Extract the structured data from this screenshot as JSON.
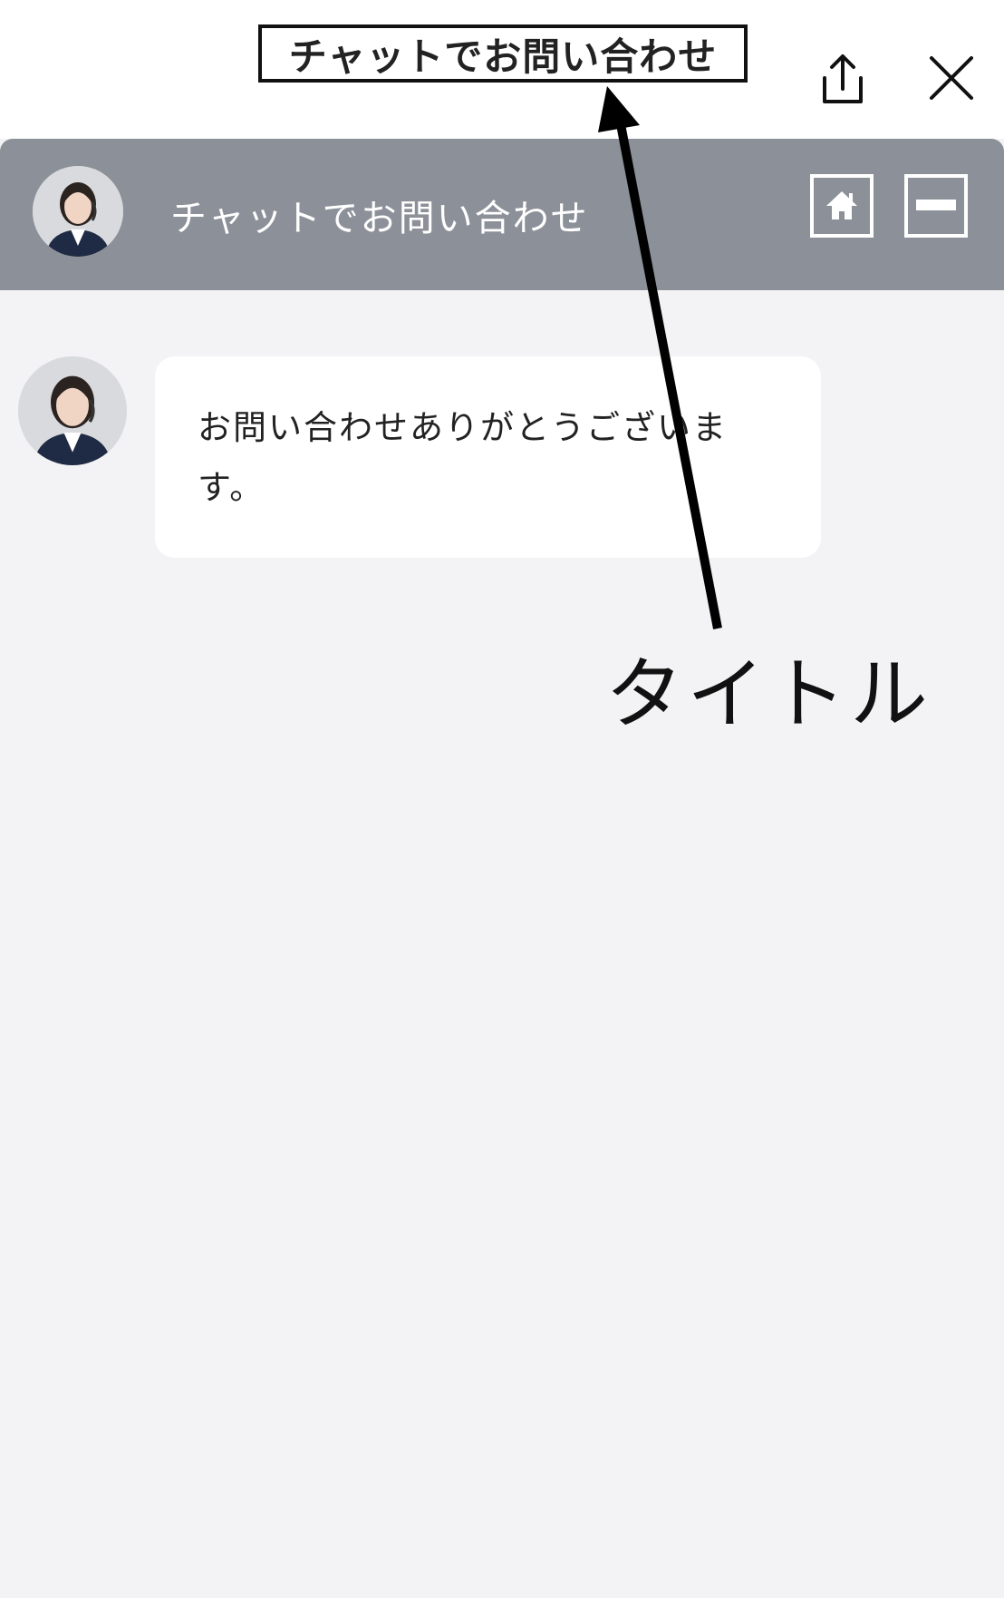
{
  "top_bar": {
    "page_title": "チャットでお問い合わせ",
    "share_icon": "share-icon",
    "close_icon": "close-icon"
  },
  "chat_header": {
    "title": "チャットでお問い合わせ",
    "avatar_icon": "operator-avatar",
    "home_icon": "home-icon",
    "minimize_icon": "minimize-icon",
    "background_color": "#8c9098"
  },
  "messages": [
    {
      "sender": "operator",
      "text": "お問い合わせありがとうございます。"
    }
  ],
  "annotation": {
    "label": "タイトル"
  },
  "colors": {
    "background": "#f3f3f5",
    "bubble": "#ffffff",
    "header": "#8c9098"
  }
}
